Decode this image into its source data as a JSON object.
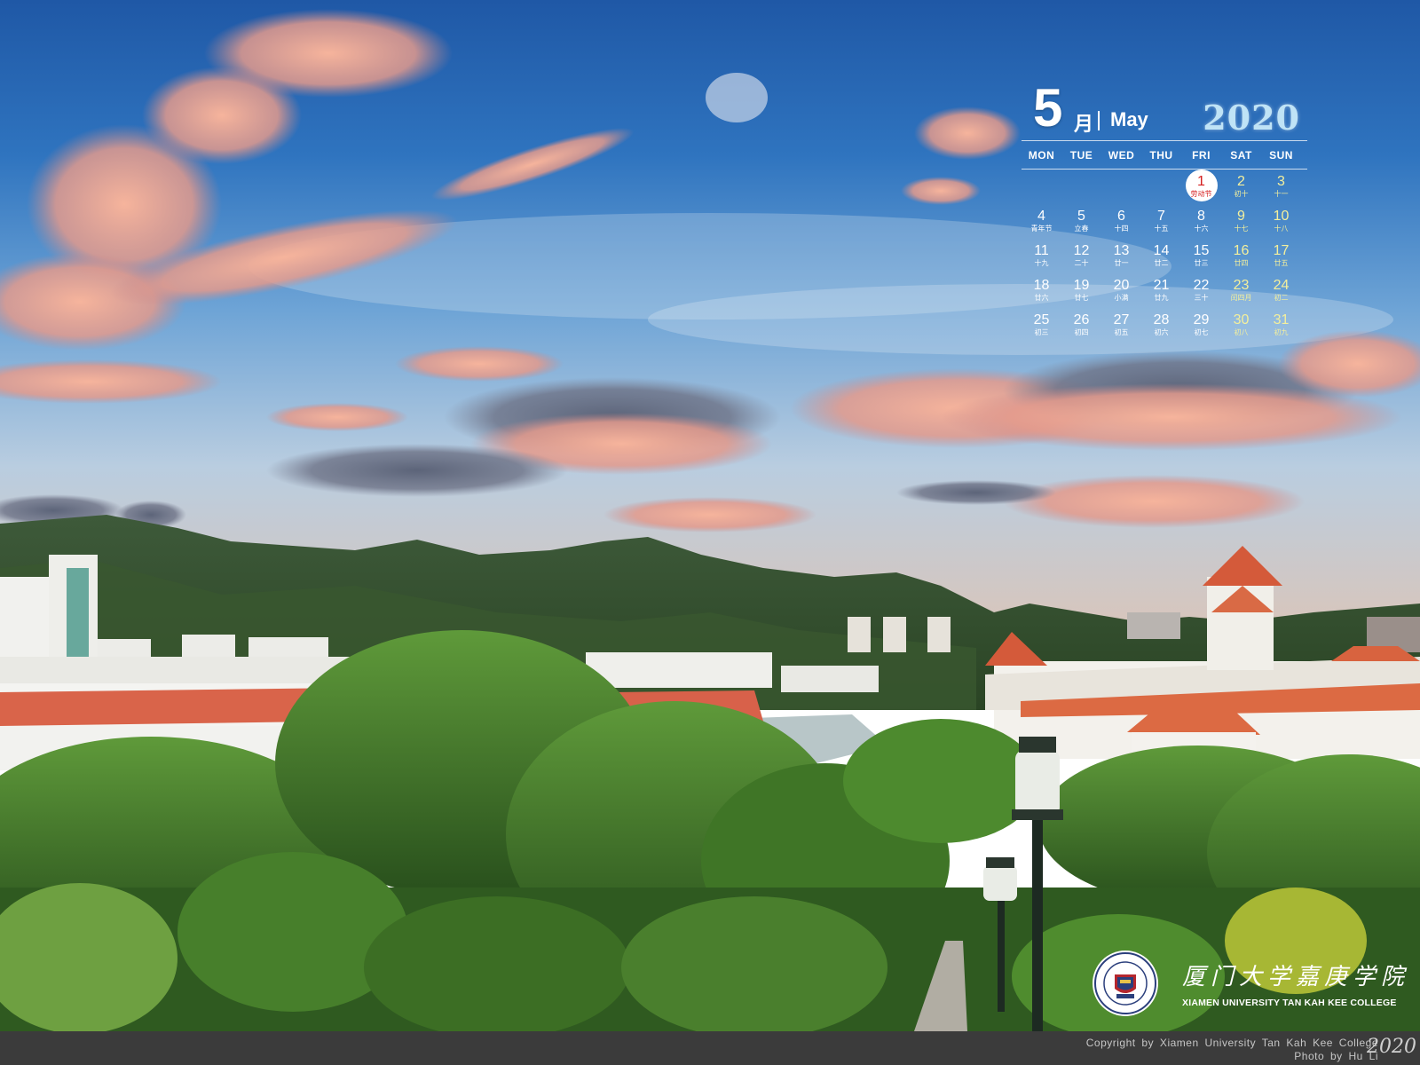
{
  "calendar": {
    "month_number": "5",
    "month_cn": "月",
    "month_en": "May",
    "year": "2020",
    "weekdays": [
      "MON",
      "TUE",
      "WED",
      "THU",
      "FRI",
      "SAT",
      "SUN"
    ],
    "leading_blank_days": 4,
    "days": [
      {
        "day": "1",
        "sub": "劳动节",
        "today": true
      },
      {
        "day": "2",
        "sub": "初十"
      },
      {
        "day": "3",
        "sub": "十一"
      },
      {
        "day": "4",
        "sub": "青年节"
      },
      {
        "day": "5",
        "sub": "立春"
      },
      {
        "day": "6",
        "sub": "十四"
      },
      {
        "day": "7",
        "sub": "十五"
      },
      {
        "day": "8",
        "sub": "十六"
      },
      {
        "day": "9",
        "sub": "十七"
      },
      {
        "day": "10",
        "sub": "十八"
      },
      {
        "day": "11",
        "sub": "十九"
      },
      {
        "day": "12",
        "sub": "二十"
      },
      {
        "day": "13",
        "sub": "廿一"
      },
      {
        "day": "14",
        "sub": "廿二"
      },
      {
        "day": "15",
        "sub": "廿三"
      },
      {
        "day": "16",
        "sub": "廿四"
      },
      {
        "day": "17",
        "sub": "廿五"
      },
      {
        "day": "18",
        "sub": "廿六"
      },
      {
        "day": "19",
        "sub": "廿七"
      },
      {
        "day": "20",
        "sub": "小满"
      },
      {
        "day": "21",
        "sub": "廿九"
      },
      {
        "day": "22",
        "sub": "三十"
      },
      {
        "day": "23",
        "sub": "闰四月"
      },
      {
        "day": "24",
        "sub": "初二"
      },
      {
        "day": "25",
        "sub": "初三"
      },
      {
        "day": "26",
        "sub": "初四"
      },
      {
        "day": "27",
        "sub": "初五"
      },
      {
        "day": "28",
        "sub": "初六"
      },
      {
        "day": "29",
        "sub": "初七"
      },
      {
        "day": "30",
        "sub": "初八"
      },
      {
        "day": "31",
        "sub": "初九"
      }
    ]
  },
  "brand": {
    "cn_name": "厦门大学嘉庚学院",
    "en_name": "XIAMEN UNIVERSITY TAN KAH KEE COLLEGE",
    "seal_ring_text": "厦门大学嘉庚学院 XIAMEN UNIVERSITY TAN KAH KEE COLLEGE",
    "seal_year": "2003"
  },
  "footer": {
    "copyright": "Copyright by Xiamen University Tan Kah Kee College",
    "photo_credit": "Photo by Hu Li",
    "year": "2020"
  },
  "colors": {
    "weekend": "#f3ef9d",
    "today_red": "#d41e1e",
    "year_blue": "#bfe3f6",
    "footer_bg": "#3b3b3b"
  }
}
